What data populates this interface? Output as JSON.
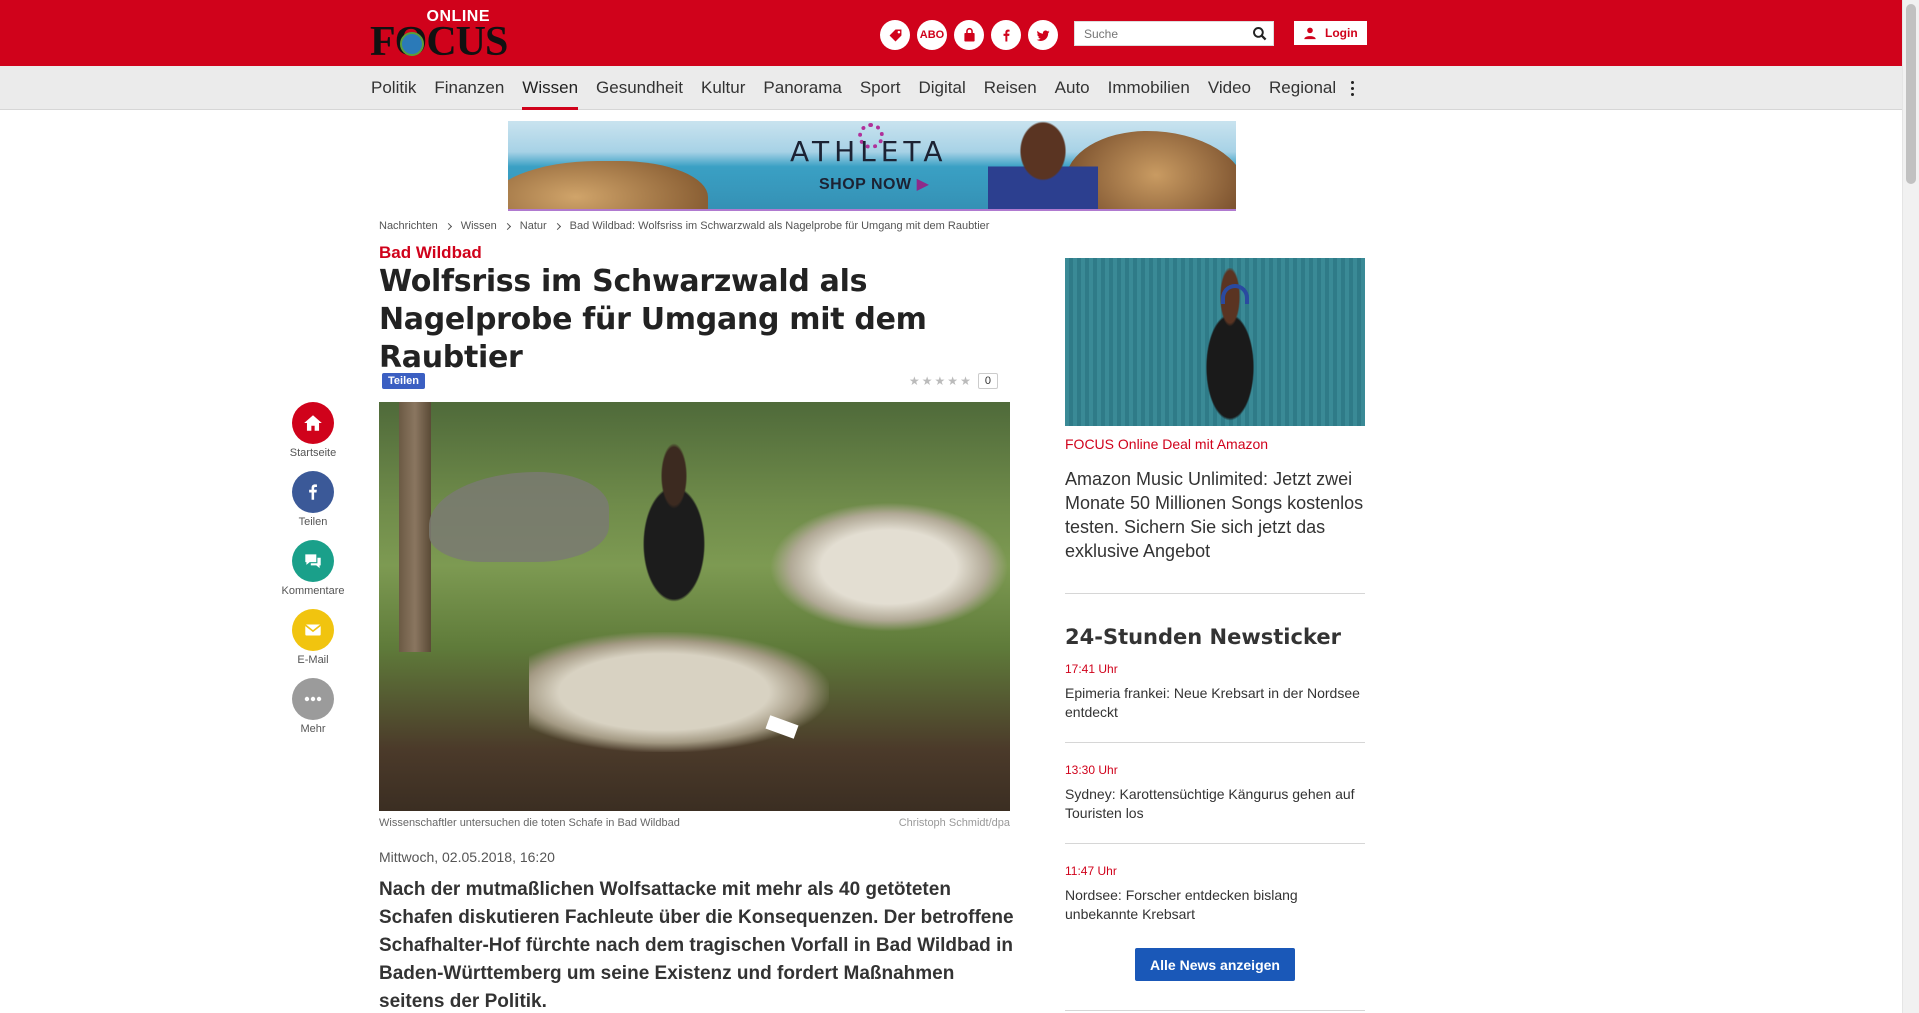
{
  "header": {
    "logo_online": "ONLINE",
    "logo_focus": "FOCUS",
    "abo_label": "ABO",
    "search_placeholder": "Suche",
    "login_label": "Login",
    "brand_color": "#d0021b",
    "icons": [
      "deals-icon",
      "abo-icon",
      "shop-bag-icon",
      "facebook-icon",
      "twitter-icon"
    ]
  },
  "nav": {
    "items": [
      "Politik",
      "Finanzen",
      "Wissen",
      "Gesundheit",
      "Kultur",
      "Panorama",
      "Sport",
      "Digital",
      "Reisen",
      "Auto",
      "Immobilien",
      "Video",
      "Regional"
    ],
    "active": "Wissen"
  },
  "ad": {
    "brand": "ATHLETA",
    "cta": "SHOP NOW"
  },
  "breadcrumb": [
    "Nachrichten",
    "Wissen",
    "Natur",
    "Bad Wildbad: Wolfsriss im Schwarzwald als Nagelprobe für Umgang mit dem Raubtier"
  ],
  "article": {
    "kicker": "Bad Wildbad",
    "headline": "Wolfsriss im Schwarzwald als Nagelprobe für Umgang mit dem Raubtier",
    "share_label": "Teilen",
    "rating_count": "0",
    "caption": "Wissenschaftler untersuchen die toten Schafe in Bad Wildbad",
    "credit": "Christoph Schmidt/dpa",
    "date": "Mittwoch, 02.05.2018, 16:20",
    "lead": "Nach der mutmaßlichen Wolfsattacke mit mehr als 40 getöteten Schafen diskutieren Fachleute über die Konsequenzen. Der betroffene Schafhalter-Hof fürchte nach dem tragischen Vorfall in Bad Wildbad in Baden-Württemberg um seine Existenz und fordert Maßnahmen seitens der Politik."
  },
  "sharebar": [
    {
      "label": "Startseite",
      "icon": "home-icon",
      "color": "#d0021b"
    },
    {
      "label": "Teilen",
      "icon": "facebook-icon",
      "color": "#3b5998"
    },
    {
      "label": "Kommentare",
      "icon": "comments-icon",
      "color": "#1aa08a"
    },
    {
      "label": "E-Mail",
      "icon": "mail-icon",
      "color": "#f1c40f"
    },
    {
      "label": "Mehr",
      "icon": "more-icon",
      "color": "#9b9b9b"
    }
  ],
  "sidebar": {
    "promo_kicker": "FOCUS Online Deal mit Amazon",
    "promo_text": "Amazon Music Unlimited: Jetzt zwei Monate 50 Millionen Songs kostenlos testen. Sichern Sie sich jetzt das exklusive Angebot",
    "ticker_title": "24-Stunden Newsticker",
    "ticker": [
      {
        "time": "17:41 Uhr",
        "text": "Epimeria frankei: Neue Krebsart in der Nordsee entdeckt"
      },
      {
        "time": "13:30 Uhr",
        "text": "Sydney: Karottensüchtige Kängurus gehen auf Touristen los"
      },
      {
        "time": "11:47 Uhr",
        "text": "Nordsee: Forscher entdecken bislang unbekannte Krebsart"
      }
    ],
    "all_news_label": "Alle News anzeigen"
  }
}
